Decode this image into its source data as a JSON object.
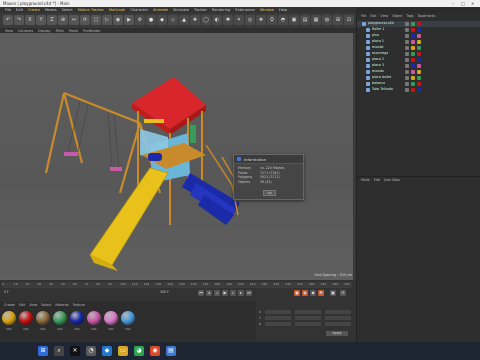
{
  "window": {
    "title": "Maxon | playground.c4d *] - Main"
  },
  "menu": {
    "items": [
      "File",
      "Edit",
      "Create",
      "Modes",
      "Select",
      "Motion Tracker",
      "MoGraph",
      "Character",
      "Animate",
      "Simulate",
      "Tracker",
      "Rendering",
      "Extensions",
      "Window",
      "Help"
    ],
    "highlight": [
      "Create",
      "Motion Tracker",
      "MoGraph",
      "Animate",
      "Window"
    ]
  },
  "toolbar": {
    "buttons": [
      "↶",
      "↷",
      "X",
      "Y",
      "Z",
      "⊕",
      "↔",
      "⟳",
      "□",
      "▷",
      "◉",
      "▶",
      "⚙",
      "●",
      "◆",
      "◇",
      "▲",
      "✚",
      "◯",
      "◐",
      "✱",
      "✶",
      "◎",
      "❖",
      "⛭",
      "◓",
      "▣",
      "▤",
      "▦",
      "◍",
      "⊞",
      "⊡"
    ]
  },
  "subbar": {
    "items": [
      "View",
      "Cameras",
      "Display",
      "Filter",
      "Panel",
      "ProRender"
    ]
  },
  "viewport": {
    "grid_note": "Grid Spacing : 100 cm"
  },
  "info_dialog": {
    "title": "Information",
    "rows": [
      {
        "key": "Memory",
        "value": "ca. 220 Mbytes"
      },
      {
        "key": "Points",
        "value": "7171 (7181)"
      },
      {
        "key": "Polygons",
        "value": "5921 (7171)"
      },
      {
        "key": "Objects",
        "value": "36 (42)"
      }
    ],
    "ok_label": "OK"
  },
  "timeline": {
    "ticks": [
      "0",
      "10",
      "20",
      "30",
      "40",
      "50",
      "60",
      "70",
      "80",
      "90",
      "100",
      "110",
      "120",
      "130",
      "140",
      "150",
      "160",
      "170",
      "180",
      "190",
      "200",
      "210",
      "220",
      "230",
      "240",
      "250",
      "260",
      "270",
      "280",
      "290"
    ],
    "current_frame": "0 F",
    "end_frame": "300 F"
  },
  "materials": {
    "menu": [
      "Create",
      "Edit",
      "View",
      "Select",
      "Material",
      "Texture"
    ],
    "items": [
      {
        "name": "Mat",
        "color": "#d9a514"
      },
      {
        "name": "Mat",
        "color": "#c81414"
      },
      {
        "name": "Mat",
        "color": "#8a6a3a"
      },
      {
        "name": "Mat",
        "color": "#3a9a5a"
      },
      {
        "name": "Mat",
        "color": "#1a2aa8"
      },
      {
        "name": "Mat",
        "color": "#c85aa8"
      },
      {
        "name": "Mat",
        "color": "#d87ac8"
      },
      {
        "name": "Mat",
        "color": "#4a9ad8"
      }
    ]
  },
  "coords": {
    "labels": [
      "X",
      "Y",
      "Z"
    ],
    "apply_label": "Apply"
  },
  "objects": {
    "menu": [
      "File",
      "Edit",
      "View",
      "Object",
      "Tags",
      "Bookmarks"
    ],
    "rows": [
      {
        "name": "playground.c4d",
        "indent": 0
      },
      {
        "name": "Roller 1",
        "indent": 1
      },
      {
        "name": "pino",
        "indent": 1
      },
      {
        "name": "placa 1",
        "indent": 1
      },
      {
        "name": "escalai",
        "indent": 1
      },
      {
        "name": "escorrega",
        "indent": 1
      },
      {
        "name": "placa 2",
        "indent": 1
      },
      {
        "name": "placa 3",
        "indent": 1
      },
      {
        "name": "escada",
        "indent": 1
      },
      {
        "name": "placa bullet",
        "indent": 1
      },
      {
        "name": "balanco",
        "indent": 1
      },
      {
        "name": "Toko Telhado",
        "indent": 1
      }
    ]
  },
  "attributes": {
    "menu": [
      "Mode",
      "Edit",
      "User Data"
    ]
  },
  "taskbar": {
    "icons": [
      "start-icon",
      "search-icon",
      "x-icon",
      "cinema4d-icon",
      "vscode-icon",
      "folder-icon",
      "whatsapp-icon",
      "chrome-icon",
      "photos-icon"
    ]
  },
  "colors": {
    "roof": "#d8262a",
    "yellow": "#e8c21a",
    "blue": "#1a2aa8",
    "wood": "#c88a2a",
    "cyan": "#6ab6d8"
  }
}
